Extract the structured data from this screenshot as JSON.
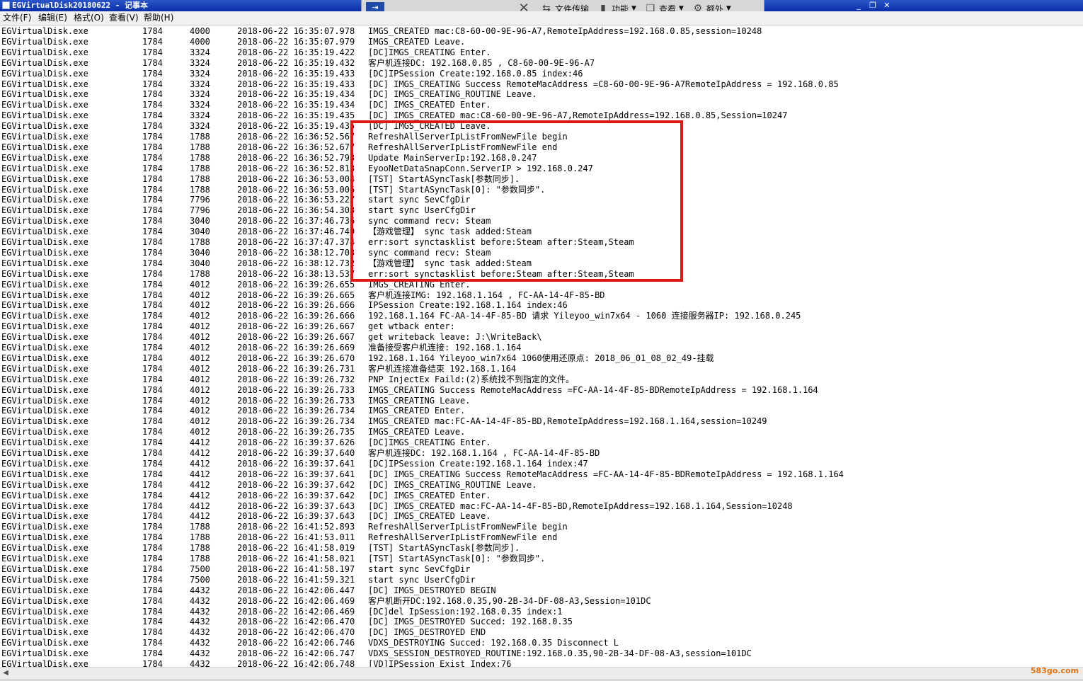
{
  "window": {
    "title": "EGVirtualDisk20180622 - 记事本"
  },
  "rdbar": {
    "buttons": [
      {
        "label": "文件传输",
        "icon": "file-transfer-icon"
      },
      {
        "label": "功能",
        "icon": "function-icon"
      },
      {
        "label": "查看",
        "icon": "view-icon"
      },
      {
        "label": "额外",
        "icon": "gear-icon"
      }
    ]
  },
  "menu": [
    "文件(F)",
    "编辑(E)",
    "格式(O)",
    "查看(V)",
    "帮助(H)"
  ],
  "log": [
    [
      "EGVirtualDisk.exe",
      "1784",
      "4000",
      "2018-06-22 16:35:07.978",
      "IMGS_CREATED mac:C8-60-00-9E-96-A7,RemoteIpAddress=192.168.0.85,session=10248"
    ],
    [
      "EGVirtualDisk.exe",
      "1784",
      "4000",
      "2018-06-22 16:35:07.979",
      "IMGS_CREATED Leave."
    ],
    [
      "EGVirtualDisk.exe",
      "1784",
      "3324",
      "2018-06-22 16:35:19.422",
      "[DC]IMGS_CREATING Enter."
    ],
    [
      "EGVirtualDisk.exe",
      "1784",
      "3324",
      "2018-06-22 16:35:19.432",
      "客户机连接DC: 192.168.0.85 , C8-60-00-9E-96-A7"
    ],
    [
      "EGVirtualDisk.exe",
      "1784",
      "3324",
      "2018-06-22 16:35:19.433",
      "[DC]IPSession Create:192.168.0.85 index:46"
    ],
    [
      "EGVirtualDisk.exe",
      "1784",
      "3324",
      "2018-06-22 16:35:19.433",
      "[DC] IMGS_CREATING Success RemoteMacAddress =C8-60-00-9E-96-A7RemoteIpAddress  = 192.168.0.85"
    ],
    [
      "EGVirtualDisk.exe",
      "1784",
      "3324",
      "2018-06-22 16:35:19.434",
      "[DC] IMGS_CREATING_ROUTINE Leave."
    ],
    [
      "EGVirtualDisk.exe",
      "1784",
      "3324",
      "2018-06-22 16:35:19.434",
      "[DC] IMGS_CREATED Enter."
    ],
    [
      "EGVirtualDisk.exe",
      "1784",
      "3324",
      "2018-06-22 16:35:19.435",
      "[DC] IMGS_CREATED mac:C8-60-00-9E-96-A7,RemoteIpAddress=192.168.0.85,Session=10247"
    ],
    [
      "EGVirtualDisk.exe",
      "1784",
      "3324",
      "2018-06-22 16:35:19.435",
      "[DC] IMGS_CREATED Leave."
    ],
    [
      "EGVirtualDisk.exe",
      "1784",
      "1788",
      "2018-06-22 16:36:52.567",
      "RefreshAllServerIpListFromNewFile begin"
    ],
    [
      "EGVirtualDisk.exe",
      "1784",
      "1788",
      "2018-06-22 16:36:52.677",
      "RefreshAllServerIpListFromNewFile end"
    ],
    [
      "EGVirtualDisk.exe",
      "1784",
      "1788",
      "2018-06-22 16:36:52.793",
      "Update MainServerIp:192.168.0.247"
    ],
    [
      "EGVirtualDisk.exe",
      "1784",
      "1788",
      "2018-06-22 16:36:52.813",
      "EyooNetDataSnapConn.ServerIP > 192.168.0.247"
    ],
    [
      "EGVirtualDisk.exe",
      "1784",
      "1788",
      "2018-06-22 16:36:53.004",
      "[TST] StartASyncTask[参数同步]."
    ],
    [
      "EGVirtualDisk.exe",
      "1784",
      "1788",
      "2018-06-22 16:36:53.006",
      "[TST] StartASyncTask[0]: \"参数同步\"."
    ],
    [
      "EGVirtualDisk.exe",
      "1784",
      "7796",
      "2018-06-22 16:36:53.227",
      "start sync SevCfgDir"
    ],
    [
      "EGVirtualDisk.exe",
      "1784",
      "7796",
      "2018-06-22 16:36:54.303",
      "start sync UserCfgDir"
    ],
    [
      "EGVirtualDisk.exe",
      "1784",
      "3040",
      "2018-06-22 16:37:46.736",
      "sync command recv: Steam"
    ],
    [
      "EGVirtualDisk.exe",
      "1784",
      "3040",
      "2018-06-22 16:37:46.749",
      "【游戏管理】      sync task added:Steam"
    ],
    [
      "EGVirtualDisk.exe",
      "1784",
      "1788",
      "2018-06-22 16:37:47.374",
      "err:sort synctasklist before:Steam after:Steam,Steam"
    ],
    [
      "EGVirtualDisk.exe",
      "1784",
      "3040",
      "2018-06-22 16:38:12.703",
      "sync command recv: Steam"
    ],
    [
      "EGVirtualDisk.exe",
      "1784",
      "3040",
      "2018-06-22 16:38:12.732",
      "【游戏管理】      sync task added:Steam"
    ],
    [
      "EGVirtualDisk.exe",
      "1784",
      "1788",
      "2018-06-22 16:38:13.537",
      "err:sort synctasklist before:Steam after:Steam,Steam"
    ],
    [
      "EGVirtualDisk.exe",
      "1784",
      "4012",
      "2018-06-22 16:39:26.655",
      "IMGS_CREATING Enter."
    ],
    [
      "EGVirtualDisk.exe",
      "1784",
      "4012",
      "2018-06-22 16:39:26.665",
      "客户机连接IMG: 192.168.1.164 , FC-AA-14-4F-85-BD"
    ],
    [
      "EGVirtualDisk.exe",
      "1784",
      "4012",
      "2018-06-22 16:39:26.666",
      "IPSession Create:192.168.1.164 index:46"
    ],
    [
      "EGVirtualDisk.exe",
      "1784",
      "4012",
      "2018-06-22 16:39:26.666",
      "192.168.1.164 FC-AA-14-4F-85-BD  请求 Yileyoo_win7x64 - 1060 连接服务器IP: 192.168.0.245"
    ],
    [
      "EGVirtualDisk.exe",
      "1784",
      "4012",
      "2018-06-22 16:39:26.667",
      "get wtback enter:"
    ],
    [
      "EGVirtualDisk.exe",
      "1784",
      "4012",
      "2018-06-22 16:39:26.667",
      "get writeback leave: J:\\WriteBack\\"
    ],
    [
      "EGVirtualDisk.exe",
      "1784",
      "4012",
      "2018-06-22 16:39:26.669",
      "准备接受客户机连接:  192.168.1.164"
    ],
    [
      "EGVirtualDisk.exe",
      "1784",
      "4012",
      "2018-06-22 16:39:26.670",
      "192.168.1.164 Yileyoo_win7x64 1060使用还原点: 2018_06_01_08_02_49-挂载"
    ],
    [
      "EGVirtualDisk.exe",
      "1784",
      "4012",
      "2018-06-22 16:39:26.731",
      "客户机连接准备结束 192.168.1.164"
    ],
    [
      "EGVirtualDisk.exe",
      "1784",
      "4012",
      "2018-06-22 16:39:26.732",
      "PNP InjectEx Faild:(2)系统找不到指定的文件。"
    ],
    [
      "EGVirtualDisk.exe",
      "1784",
      "4012",
      "2018-06-22 16:39:26.733",
      "IMGS_CREATING Success RemoteMacAddress =FC-AA-14-4F-85-BDRemoteIpAddress  = 192.168.1.164"
    ],
    [
      "EGVirtualDisk.exe",
      "1784",
      "4012",
      "2018-06-22 16:39:26.733",
      "IMGS_CREATING Leave."
    ],
    [
      "EGVirtualDisk.exe",
      "1784",
      "4012",
      "2018-06-22 16:39:26.734",
      "IMGS_CREATED Enter."
    ],
    [
      "EGVirtualDisk.exe",
      "1784",
      "4012",
      "2018-06-22 16:39:26.734",
      "IMGS_CREATED mac:FC-AA-14-4F-85-BD,RemoteIpAddress=192.168.1.164,session=10249"
    ],
    [
      "EGVirtualDisk.exe",
      "1784",
      "4012",
      "2018-06-22 16:39:26.735",
      "IMGS_CREATED Leave."
    ],
    [
      "EGVirtualDisk.exe",
      "1784",
      "4412",
      "2018-06-22 16:39:37.626",
      "[DC]IMGS_CREATING Enter."
    ],
    [
      "EGVirtualDisk.exe",
      "1784",
      "4412",
      "2018-06-22 16:39:37.640",
      "客户机连接DC: 192.168.1.164 , FC-AA-14-4F-85-BD"
    ],
    [
      "EGVirtualDisk.exe",
      "1784",
      "4412",
      "2018-06-22 16:39:37.641",
      "[DC]IPSession Create:192.168.1.164 index:47"
    ],
    [
      "EGVirtualDisk.exe",
      "1784",
      "4412",
      "2018-06-22 16:39:37.641",
      "[DC] IMGS_CREATING Success RemoteMacAddress =FC-AA-14-4F-85-BDRemoteIpAddress  = 192.168.1.164"
    ],
    [
      "EGVirtualDisk.exe",
      "1784",
      "4412",
      "2018-06-22 16:39:37.642",
      "[DC] IMGS_CREATING_ROUTINE Leave."
    ],
    [
      "EGVirtualDisk.exe",
      "1784",
      "4412",
      "2018-06-22 16:39:37.642",
      "[DC] IMGS_CREATED Enter."
    ],
    [
      "EGVirtualDisk.exe",
      "1784",
      "4412",
      "2018-06-22 16:39:37.643",
      "[DC] IMGS_CREATED mac:FC-AA-14-4F-85-BD,RemoteIpAddress=192.168.1.164,Session=10248"
    ],
    [
      "EGVirtualDisk.exe",
      "1784",
      "4412",
      "2018-06-22 16:39:37.643",
      "[DC] IMGS_CREATED Leave."
    ],
    [
      "EGVirtualDisk.exe",
      "1784",
      "1788",
      "2018-06-22 16:41:52.893",
      "RefreshAllServerIpListFromNewFile begin"
    ],
    [
      "EGVirtualDisk.exe",
      "1784",
      "1788",
      "2018-06-22 16:41:53.011",
      "RefreshAllServerIpListFromNewFile end"
    ],
    [
      "EGVirtualDisk.exe",
      "1784",
      "1788",
      "2018-06-22 16:41:58.019",
      "[TST] StartASyncTask[参数同步]."
    ],
    [
      "EGVirtualDisk.exe",
      "1784",
      "1788",
      "2018-06-22 16:41:58.021",
      "[TST] StartASyncTask[0]: \"参数同步\"."
    ],
    [
      "EGVirtualDisk.exe",
      "1784",
      "7500",
      "2018-06-22 16:41:58.197",
      "start sync SevCfgDir"
    ],
    [
      "EGVirtualDisk.exe",
      "1784",
      "7500",
      "2018-06-22 16:41:59.321",
      "start sync UserCfgDir"
    ],
    [
      "EGVirtualDisk.exe",
      "1784",
      "4432",
      "2018-06-22 16:42:06.447",
      "[DC] IMGS_DESTROYED BEGIN"
    ],
    [
      "EGVirtualDisk.exe",
      "1784",
      "4432",
      "2018-06-22 16:42:06.469",
      "客户机断开DC:192.168.0.35,90-2B-34-DF-08-A3,Session=101DC"
    ],
    [
      "EGVirtualDisk.exe",
      "1784",
      "4432",
      "2018-06-22 16:42:06.469",
      "[DC]del IpSession:192.168.0.35 index:1"
    ],
    [
      "EGVirtualDisk.exe",
      "1784",
      "4432",
      "2018-06-22 16:42:06.470",
      "[DC] IMGS_DESTROYED Succed: 192.168.0.35"
    ],
    [
      "EGVirtualDisk.exe",
      "1784",
      "4432",
      "2018-06-22 16:42:06.470",
      "[DC] IMGS_DESTROYED END"
    ],
    [
      "EGVirtualDisk.exe",
      "1784",
      "4432",
      "2018-06-22 16:42:06.746",
      "VDXS_DESTROYING Succed: 192.168.0.35 Disconnect L"
    ],
    [
      "EGVirtualDisk.exe",
      "1784",
      "4432",
      "2018-06-22 16:42:06.747",
      "VDXS_SESSION_DESTROYED_ROUTINE:192.168.0.35,90-2B-34-DF-08-A3,session=101DC"
    ],
    [
      "EGVirtualDisk.exe",
      "1784",
      "4432",
      "2018-06-22 16:42:06.748",
      "[VD]IPSession Exist Index:76"
    ]
  ],
  "watermark": "583go.com",
  "highlight_color": "#e01616"
}
